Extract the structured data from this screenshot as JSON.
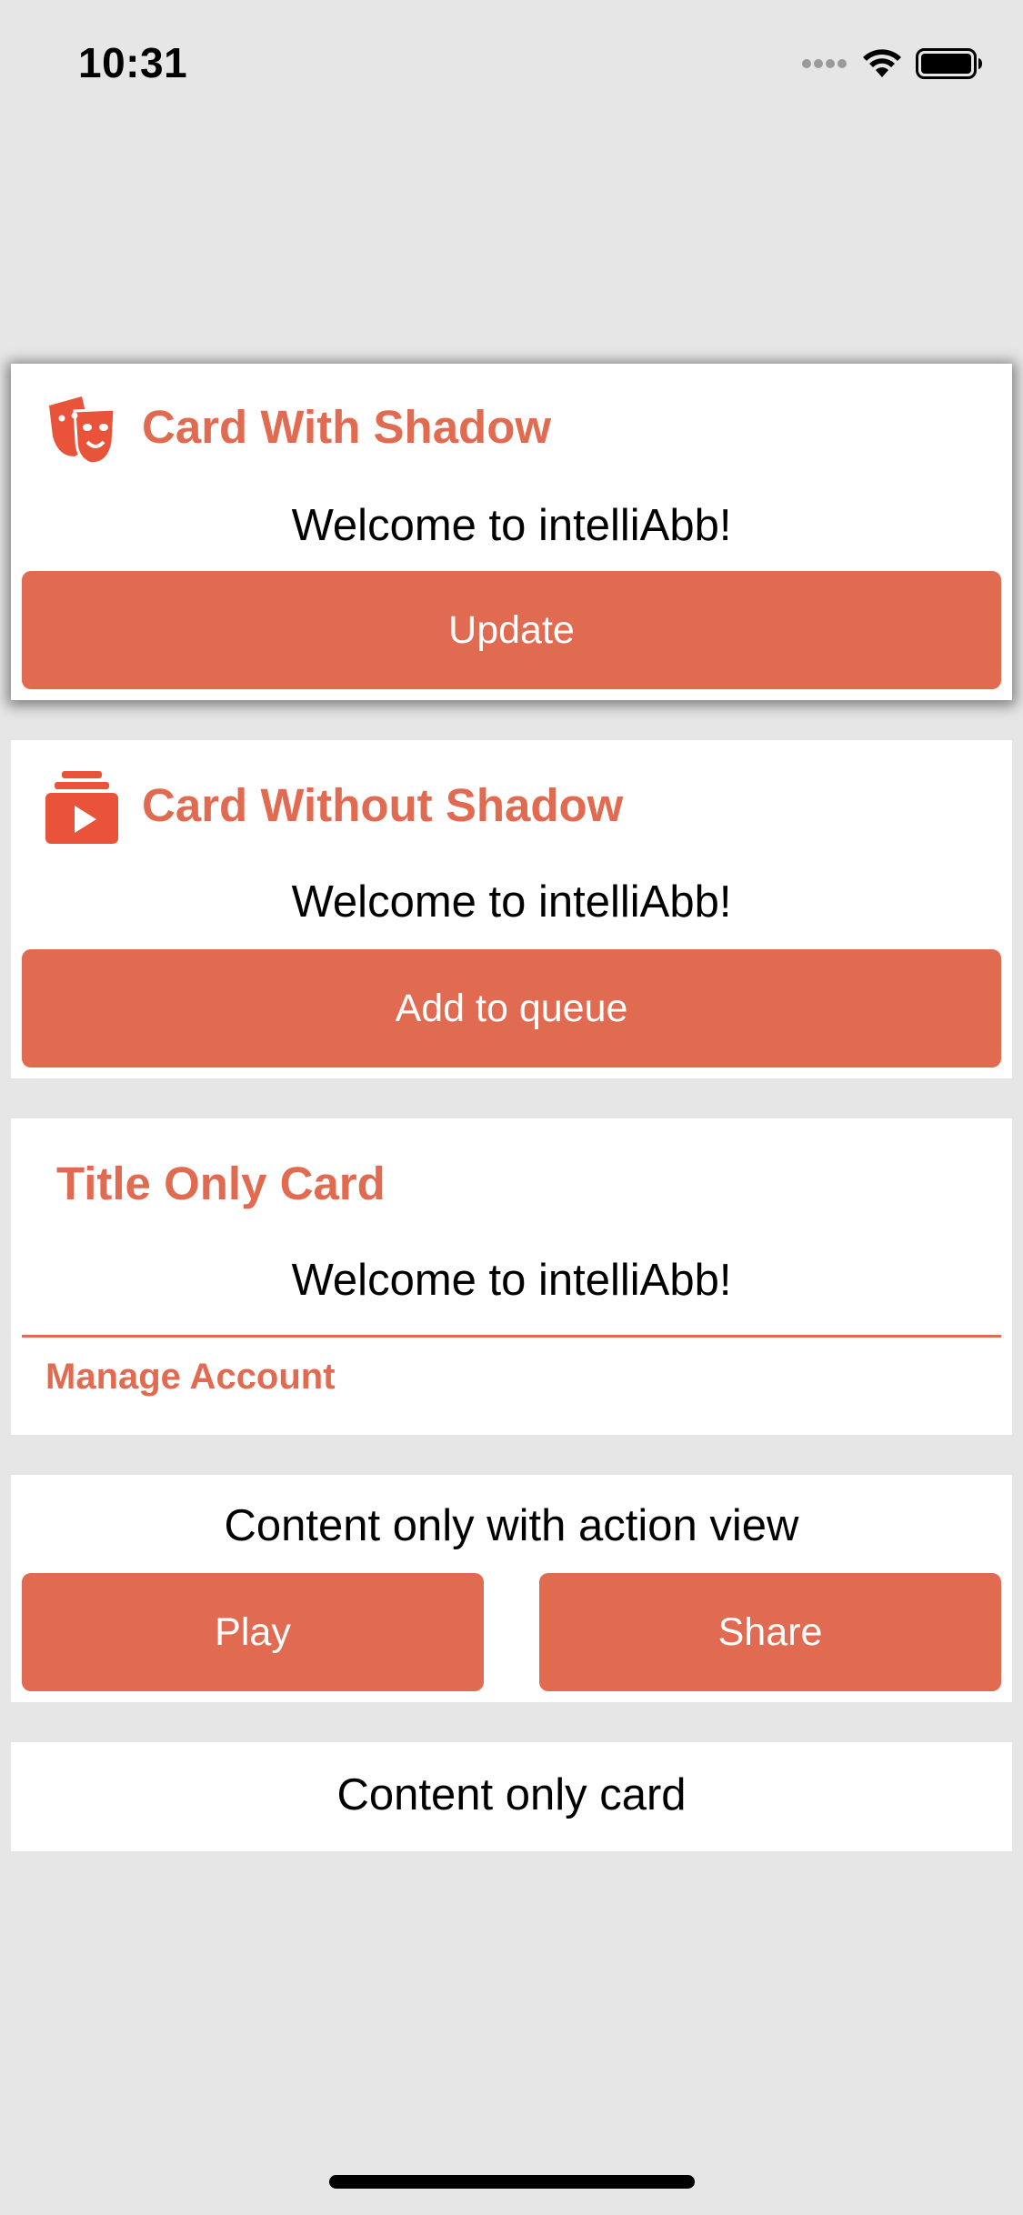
{
  "status_bar": {
    "time": "10:31",
    "icons": [
      "cellular-signal-icon",
      "wifi-icon",
      "battery-icon"
    ]
  },
  "colors": {
    "accent": "#e06b50",
    "background": "#e6e6e6",
    "card": "#ffffff"
  },
  "cards": [
    {
      "title": "Card With Shadow",
      "icon": "theater-masks-icon",
      "content": "Welcome to intelliAbb!",
      "action": "Update"
    },
    {
      "title": "Card Without Shadow",
      "icon": "video-queue-icon",
      "content": "Welcome to intelliAbb!",
      "action": "Add to queue"
    },
    {
      "title": "Title Only Card",
      "content": "Welcome to intelliAbb!",
      "link": "Manage Account"
    },
    {
      "content": "Content only with action view",
      "actions": [
        "Play",
        "Share"
      ]
    },
    {
      "content": "Content only card"
    }
  ]
}
